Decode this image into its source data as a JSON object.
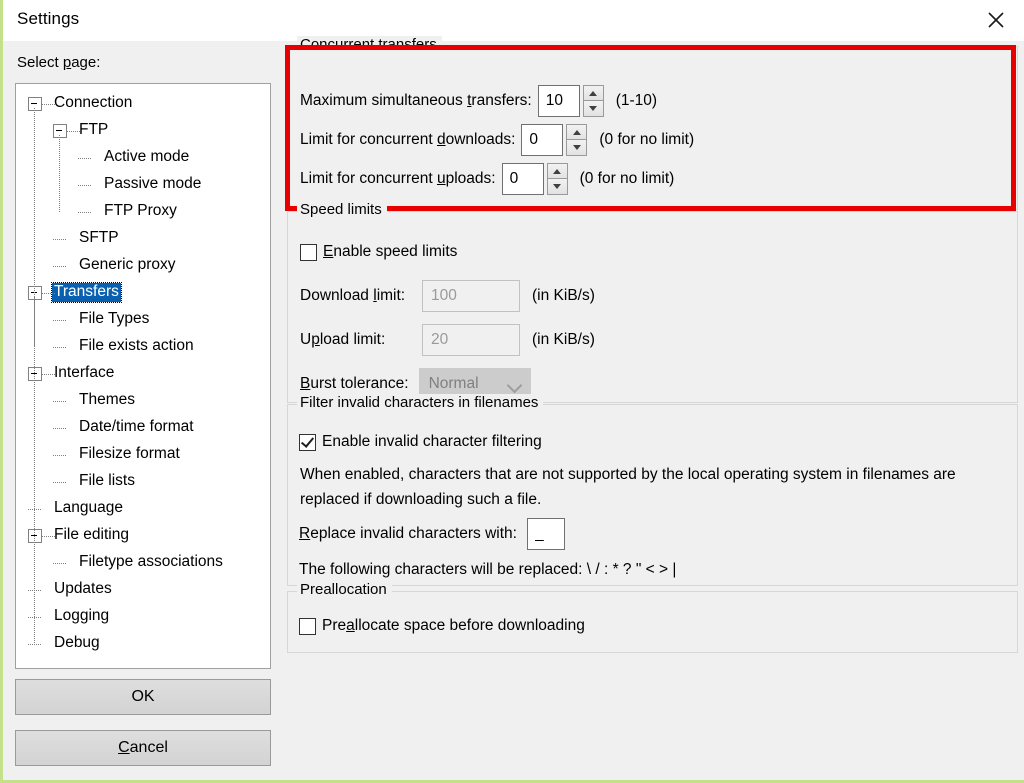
{
  "window": {
    "title": "Settings",
    "close_icon": "close-icon",
    "accent_red": "#e60000",
    "selection_blue": "#0a60b0"
  },
  "sidebar": {
    "label": "Select page:",
    "label_accel": "p",
    "tree": [
      {
        "label": "Connection",
        "depth": 0,
        "expander": "minus",
        "selected": false
      },
      {
        "label": "FTP",
        "depth": 1,
        "expander": "minus",
        "selected": false
      },
      {
        "label": "Active mode",
        "depth": 2,
        "expander": "leaf",
        "selected": false
      },
      {
        "label": "Passive mode",
        "depth": 2,
        "expander": "leaf",
        "selected": false
      },
      {
        "label": "FTP Proxy",
        "depth": 2,
        "expander": "leaf",
        "selected": false
      },
      {
        "label": "SFTP",
        "depth": 1,
        "expander": "leaf",
        "selected": false
      },
      {
        "label": "Generic proxy",
        "depth": 1,
        "expander": "leaf",
        "selected": false
      },
      {
        "label": "Transfers",
        "depth": 0,
        "expander": "minus",
        "selected": true
      },
      {
        "label": "File Types",
        "depth": 1,
        "expander": "leaf",
        "selected": false
      },
      {
        "label": "File exists action",
        "depth": 1,
        "expander": "leaf",
        "selected": false
      },
      {
        "label": "Interface",
        "depth": 0,
        "expander": "minus",
        "selected": false
      },
      {
        "label": "Themes",
        "depth": 1,
        "expander": "leaf",
        "selected": false
      },
      {
        "label": "Date/time format",
        "depth": 1,
        "expander": "leaf",
        "selected": false
      },
      {
        "label": "Filesize format",
        "depth": 1,
        "expander": "leaf",
        "selected": false
      },
      {
        "label": "File lists",
        "depth": 1,
        "expander": "leaf",
        "selected": false
      },
      {
        "label": "Language",
        "depth": 0,
        "expander": "leaf",
        "selected": false
      },
      {
        "label": "File editing",
        "depth": 0,
        "expander": "minus",
        "selected": false
      },
      {
        "label": "Filetype associations",
        "depth": 1,
        "expander": "leaf",
        "selected": false
      },
      {
        "label": "Updates",
        "depth": 0,
        "expander": "leaf",
        "selected": false
      },
      {
        "label": "Logging",
        "depth": 0,
        "expander": "leaf",
        "selected": false
      },
      {
        "label": "Debug",
        "depth": 0,
        "expander": "leaf",
        "selected": false
      }
    ]
  },
  "buttons": {
    "ok": "OK",
    "cancel_pre": "C",
    "cancel_rest": "ancel"
  },
  "concurrent": {
    "group_title": "Concurrent transfers",
    "max_label_pre": "Maximum simultaneous ",
    "max_label_acc": "t",
    "max_label_post": "ransfers:",
    "max_value": "10",
    "max_hint": "(1-10)",
    "down_label_pre": "Limit for concurrent ",
    "down_label_acc": "d",
    "down_label_post": "ownloads:",
    "down_value": "0",
    "down_hint": "(0 for no limit)",
    "up_label_pre": "Limit for concurrent ",
    "up_label_acc": "u",
    "up_label_post": "ploads:",
    "up_value": "0",
    "up_hint": "(0 for no limit)"
  },
  "speed": {
    "group_title": "Speed limits",
    "enable_pre": "",
    "enable_acc": "E",
    "enable_post": "nable speed limits",
    "enable_checked": false,
    "download_label_pre": "Download ",
    "download_label_acc": "l",
    "download_label_post": "imit:",
    "download_value": "100",
    "download_unit": "(in KiB/s)",
    "upload_label_pre": "U",
    "upload_label_acc": "p",
    "upload_label_post": "load limit:",
    "upload_value": "20",
    "upload_unit": "(in KiB/s)",
    "burst_label_acc": "B",
    "burst_label_post": "urst tolerance:",
    "burst_value": "Normal",
    "burst_disabled": true
  },
  "filter": {
    "group_title": "Filter invalid characters in filenames",
    "enable_pre": "",
    "enable_acc": "",
    "enable_label": "Enable invalid character filtering",
    "enable_checked": true,
    "description": "When enabled, characters that are not supported by the local operating system in filenames are replaced if downloading such a file.",
    "replace_label_acc": "R",
    "replace_label_post": "eplace invalid characters with:",
    "replace_value": "_",
    "replaced_chars_line": "The following characters will be replaced: \\ / : * ? \" < > |"
  },
  "prealloc": {
    "group_title": "Preallocation",
    "label_pre": "Pre",
    "label_acc": "a",
    "label_post": "llocate space before downloading",
    "checked": false
  }
}
